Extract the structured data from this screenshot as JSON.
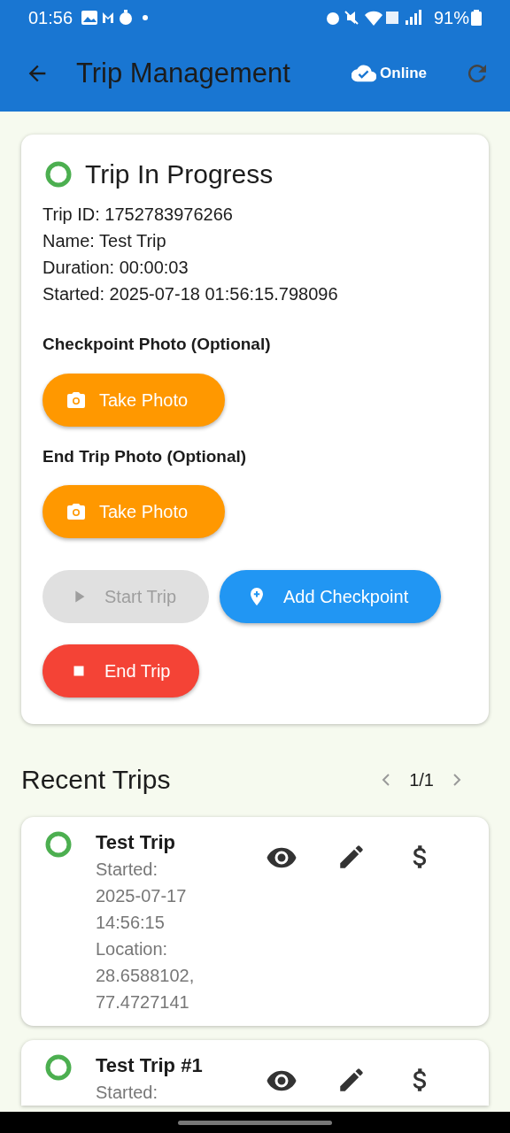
{
  "status_bar": {
    "time": "01:56",
    "battery": "91%"
  },
  "app_bar": {
    "title": "Trip Management",
    "connection": "Online"
  },
  "current_trip": {
    "status": "Trip In Progress",
    "details": [
      "Trip ID: 1752783976266",
      "Name: Test Trip",
      "Duration: 00:00:03",
      "Started: 2025-07-18 01:56:15.798096"
    ],
    "photo_sections": [
      {
        "label": "Checkpoint Photo (Optional)",
        "button": "Take Photo"
      },
      {
        "label": "End Trip Photo (Optional)",
        "button": "Take Photo"
      }
    ],
    "actions": [
      {
        "kind": "start",
        "label": "Start Trip",
        "disabled": true
      },
      {
        "kind": "checkpoint",
        "label": "Add Checkpoint",
        "disabled": false
      },
      {
        "kind": "end",
        "label": "End Trip",
        "disabled": false
      }
    ]
  },
  "recent_trips": {
    "title": "Recent Trips",
    "page": "1/1",
    "trips": [
      {
        "name": "Test Trip",
        "lines": [
          "Started:",
          "2025-07-17",
          "14:56:15",
          "Location:",
          "28.6588102,",
          "77.4727141"
        ]
      },
      {
        "name": "Test Trip #1",
        "lines": [
          "Started:"
        ]
      }
    ]
  }
}
